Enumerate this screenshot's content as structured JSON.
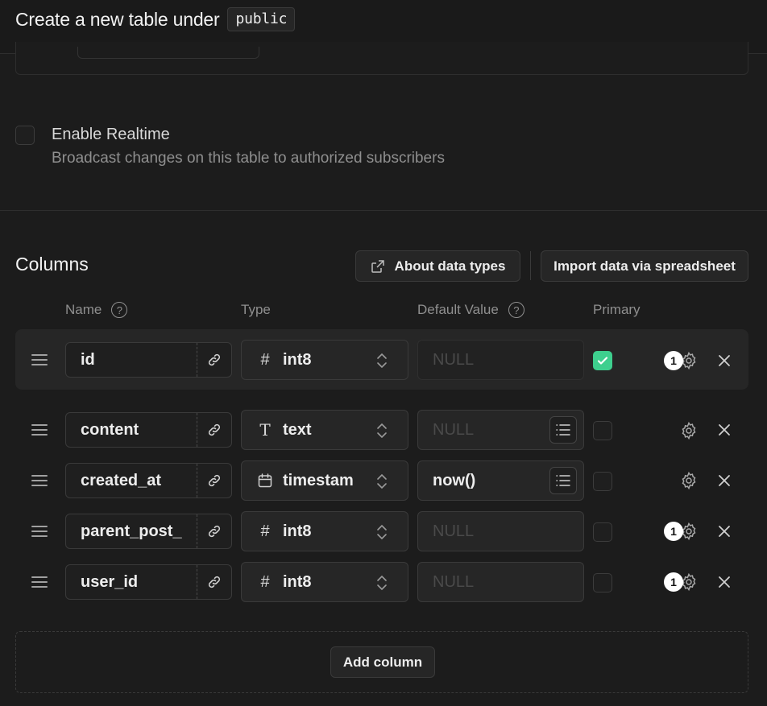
{
  "header": {
    "title": "Create a new table under",
    "schema": "public"
  },
  "realtime": {
    "label": "Enable Realtime",
    "description": "Broadcast changes on this table to authorized subscribers",
    "checked": false
  },
  "columns_section": {
    "title": "Columns",
    "about_button": "About data types",
    "import_button": "Import data via spreadsheet",
    "headers": {
      "name": "Name",
      "type": "Type",
      "default": "Default Value",
      "primary": "Primary"
    },
    "add_button": "Add column"
  },
  "rows": [
    {
      "name": "id",
      "type_icon": "hash-icon",
      "type": "int8",
      "default": "",
      "default_placeholder": "NULL",
      "primary": true,
      "badge": "1"
    },
    {
      "name": "content",
      "type_icon": "text-type-icon",
      "type": "text",
      "default": "",
      "default_placeholder": "NULL",
      "primary": false,
      "badge": ""
    },
    {
      "name": "created_at",
      "type_icon": "calendar-icon",
      "type": "timestam",
      "default": "now()",
      "default_placeholder": "",
      "primary": false,
      "badge": ""
    },
    {
      "name": "parent_post_",
      "type_icon": "hash-icon",
      "type": "int8",
      "default": "",
      "default_placeholder": "NULL",
      "primary": false,
      "badge": "1"
    },
    {
      "name": "user_id",
      "type_icon": "hash-icon",
      "type": "int8",
      "default": "",
      "default_placeholder": "NULL",
      "primary": false,
      "badge": "1"
    }
  ],
  "colors": {
    "accent": "#3ecf8e",
    "background": "#1c1c1c"
  }
}
